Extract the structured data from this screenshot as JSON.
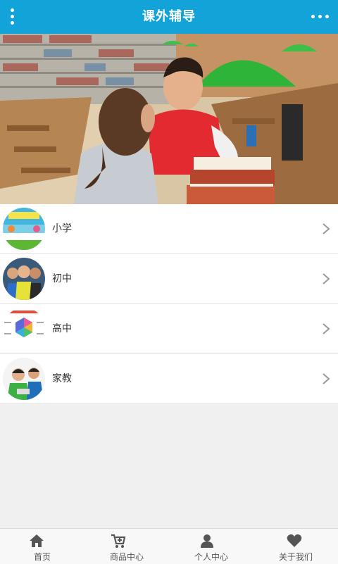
{
  "header": {
    "title": "课外辅导",
    "menu_icon": "vertical-dots-icon",
    "more_icon": "horizontal-dots-icon",
    "background": "#12a3d9"
  },
  "banner": {
    "slide_count": 3,
    "active_slide": 1
  },
  "categories": [
    {
      "label": "小学",
      "icon": "primary-school-thumbnail"
    },
    {
      "label": "初中",
      "icon": "middle-school-thumbnail"
    },
    {
      "label": "高中",
      "icon": "high-school-thumbnail"
    },
    {
      "label": "家教",
      "icon": "tutoring-thumbnail"
    }
  ],
  "tabbar": {
    "tabs": [
      {
        "label": "首页",
        "icon": "home-icon"
      },
      {
        "label": "商品中心",
        "icon": "cart-icon"
      },
      {
        "label": "个人中心",
        "icon": "user-icon"
      },
      {
        "label": "关于我们",
        "icon": "heart-icon"
      }
    ]
  }
}
